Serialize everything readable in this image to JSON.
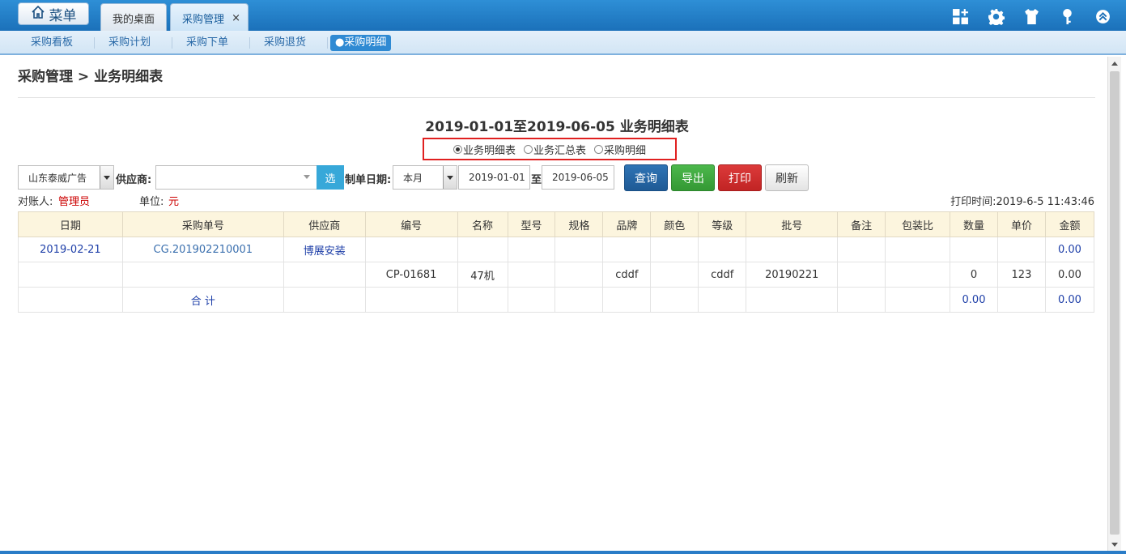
{
  "header": {
    "menu_label": "菜单",
    "tabs": [
      {
        "label": "我的桌面"
      },
      {
        "label": "采购管理",
        "close": "×"
      }
    ],
    "icons": [
      "grid-add-icon",
      "gear-icon",
      "shirt-icon",
      "key-icon",
      "collapse-up-icon"
    ]
  },
  "subnav": {
    "items": [
      "采购看板",
      "采购计划",
      "采购下单",
      "采购退货",
      "●采购明细"
    ]
  },
  "page": {
    "breadcrumb": "采购管理 > 业务明细表",
    "report_title": "2019-01-01至2019-06-05 业务明细表",
    "radios": [
      {
        "label": "业务明细表",
        "checked": true
      },
      {
        "label": "业务汇总表",
        "checked": false
      },
      {
        "label": "采购明细",
        "checked": false
      }
    ]
  },
  "filters": {
    "company_value": "山东泰威广告",
    "supplier_label": "供应商:",
    "supplier_value": "",
    "select_button": "选",
    "date_label": "制单日期:",
    "period_value": "本月",
    "date_from": "2019-01-01",
    "to_label": "至",
    "date_to": "2019-06-05",
    "buttons": {
      "query": "查询",
      "export": "导出",
      "print": "打印",
      "refresh": "刷新"
    }
  },
  "info": {
    "accountant_label": "对账人:",
    "accountant_value": "管理员",
    "unit_label": "单位:",
    "unit_value": "元",
    "print_time": "打印时间:2019-6-5 11:43:46"
  },
  "table": {
    "headers": [
      "日期",
      "采购单号",
      "供应商",
      "编号",
      "名称",
      "型号",
      "规格",
      "品牌",
      "颜色",
      "等级",
      "批号",
      "备注",
      "包装比",
      "数量",
      "单价",
      "金额"
    ],
    "rows": [
      [
        "2019-02-21",
        "CG.201902210001",
        "博展安装",
        "",
        "",
        "",
        "",
        "",
        "",
        "",
        "",
        "",
        "",
        "",
        "",
        "0.00"
      ],
      [
        "",
        "",
        "",
        "CP-01681",
        "47机",
        "",
        "",
        "cddf",
        "",
        "cddf",
        "20190221",
        "",
        "",
        "0",
        "123",
        "0.00"
      ],
      [
        "",
        "合 计",
        "",
        "",
        "",
        "",
        "",
        "",
        "",
        "",
        "",
        "",
        "",
        "0.00",
        "",
        "0.00"
      ]
    ]
  },
  "colors": {
    "header_blue": "#1a6fb8",
    "query_button": "#1f5f9f",
    "export_button": "#3aa63a",
    "print_button": "#d23030",
    "highlight_border": "#e02020"
  }
}
